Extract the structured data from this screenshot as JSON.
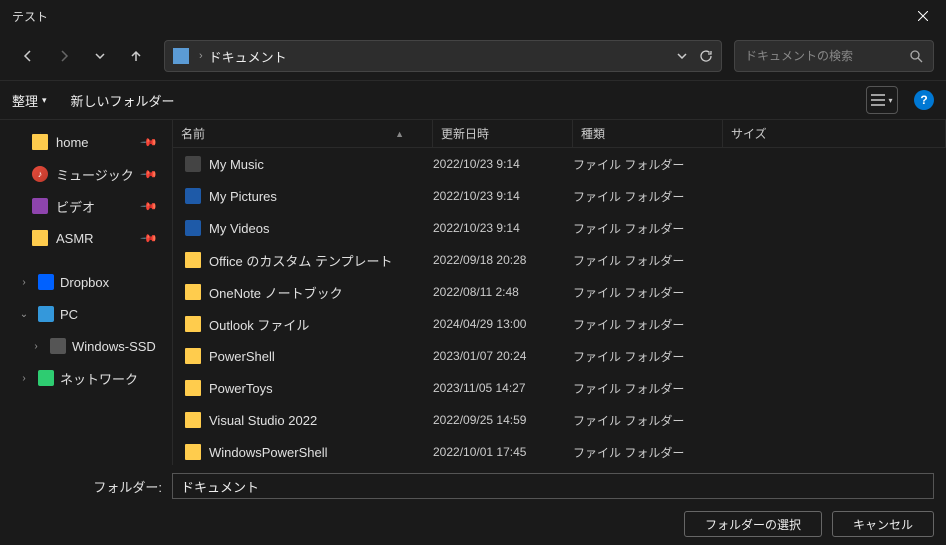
{
  "window": {
    "title": "テスト"
  },
  "breadcrumb": {
    "location": "ドキュメント"
  },
  "search": {
    "placeholder": "ドキュメントの検索"
  },
  "toolbar": {
    "organize": "整理",
    "new_folder": "新しいフォルダー"
  },
  "quick_access": [
    {
      "name": "home",
      "icon": "folder"
    },
    {
      "name": "ミュージック",
      "icon": "music"
    },
    {
      "name": "ビデオ",
      "icon": "video"
    },
    {
      "name": "ASMR",
      "icon": "folder"
    }
  ],
  "tree": {
    "dropbox": "Dropbox",
    "pc": "PC",
    "drive": "Windows-SSD",
    "network": "ネットワーク"
  },
  "columns": {
    "name": "名前",
    "date": "更新日時",
    "type": "種類",
    "size": "サイズ"
  },
  "files": [
    {
      "name": "My Music",
      "date": "2022/10/23 9:14",
      "type": "ファイル フォルダー",
      "icon": "music-f"
    },
    {
      "name": "My Pictures",
      "date": "2022/10/23 9:14",
      "type": "ファイル フォルダー",
      "icon": "pic-f"
    },
    {
      "name": "My Videos",
      "date": "2022/10/23 9:14",
      "type": "ファイル フォルダー",
      "icon": "vid-f"
    },
    {
      "name": "Office のカスタム テンプレート",
      "date": "2022/09/18 20:28",
      "type": "ファイル フォルダー",
      "icon": "folder-y"
    },
    {
      "name": "OneNote ノートブック",
      "date": "2022/08/11 2:48",
      "type": "ファイル フォルダー",
      "icon": "folder-y"
    },
    {
      "name": "Outlook ファイル",
      "date": "2024/04/29 13:00",
      "type": "ファイル フォルダー",
      "icon": "folder-y"
    },
    {
      "name": "PowerShell",
      "date": "2023/01/07 20:24",
      "type": "ファイル フォルダー",
      "icon": "folder-y"
    },
    {
      "name": "PowerToys",
      "date": "2023/11/05 14:27",
      "type": "ファイル フォルダー",
      "icon": "folder-y"
    },
    {
      "name": "Visual Studio 2022",
      "date": "2022/09/25 14:59",
      "type": "ファイル フォルダー",
      "icon": "folder-y"
    },
    {
      "name": "WindowsPowerShell",
      "date": "2022/10/01 17:45",
      "type": "ファイル フォルダー",
      "icon": "folder-y"
    }
  ],
  "footer": {
    "folder_label": "フォルダー:",
    "folder_value": "ドキュメント",
    "select": "フォルダーの選択",
    "cancel": "キャンセル"
  }
}
